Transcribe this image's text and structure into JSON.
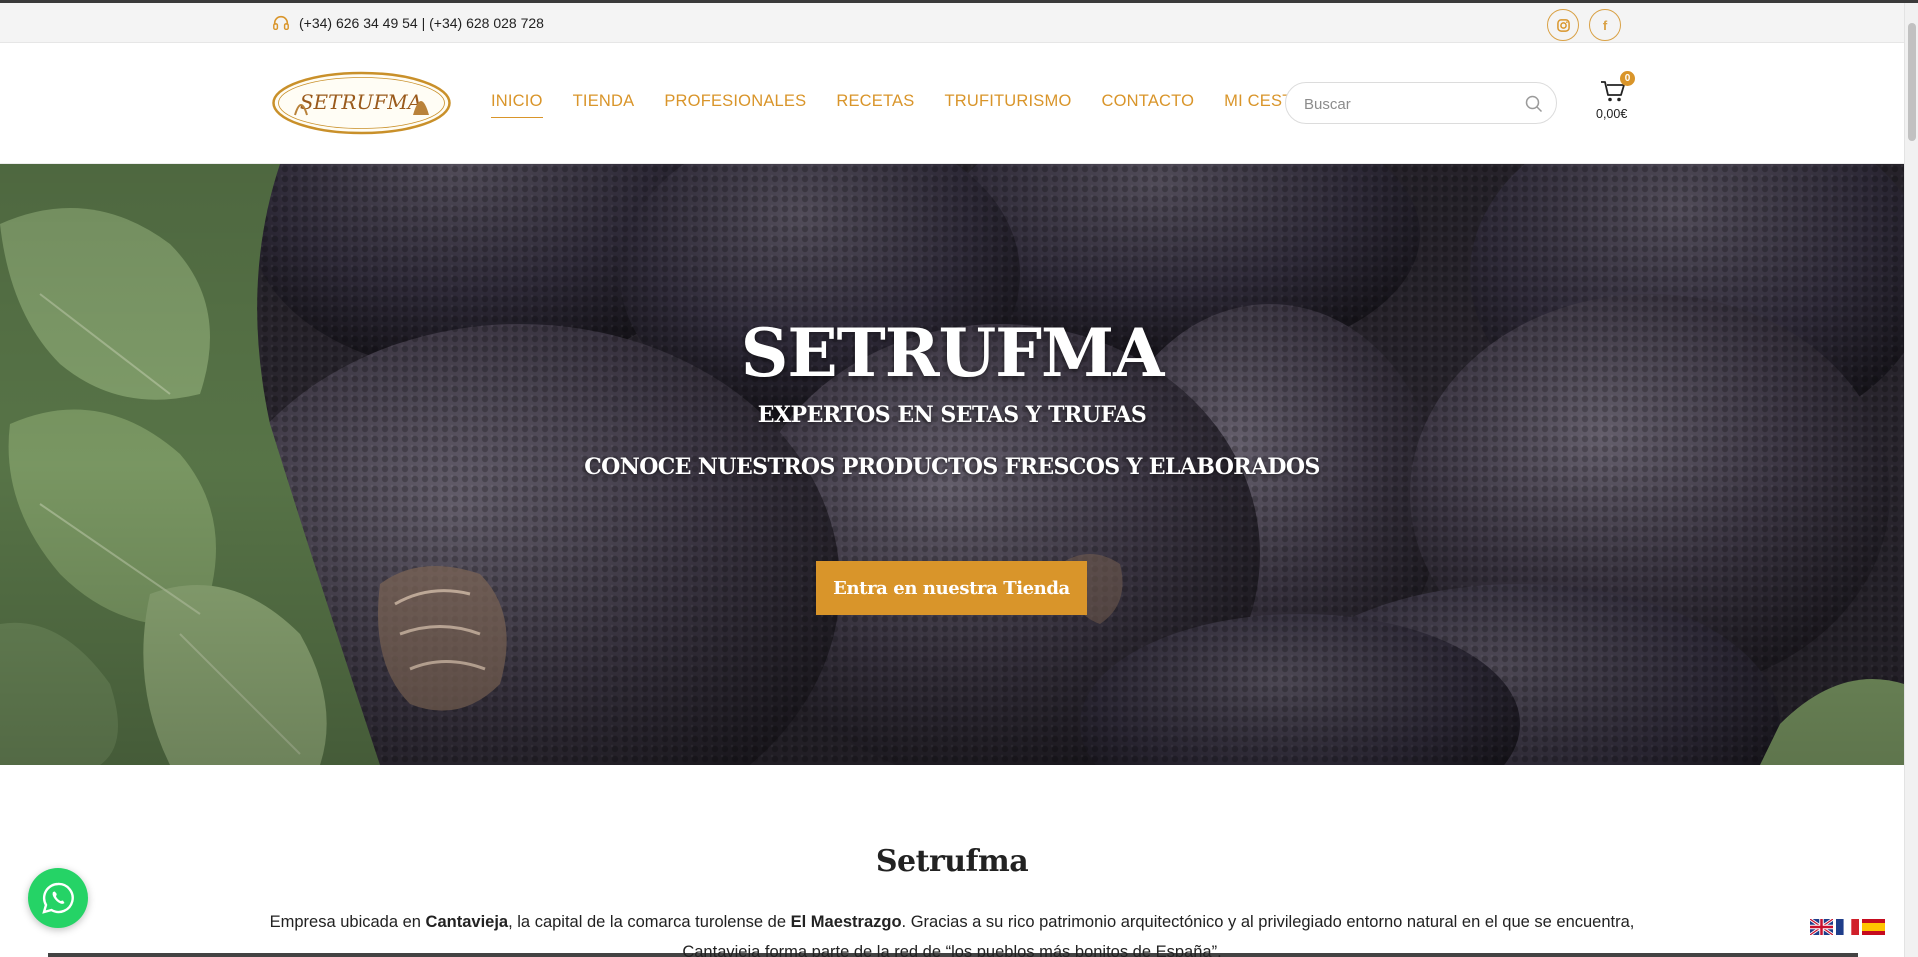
{
  "topbar": {
    "phone_icon": "headset-icon",
    "phone_text": "(+34) 626 34 49 54 | (+34) 628 028 728",
    "social": [
      {
        "name": "instagram",
        "icon": "instagram-icon",
        "glyph": "◎"
      },
      {
        "name": "facebook",
        "icon": "facebook-icon",
        "glyph": "f"
      }
    ]
  },
  "header": {
    "logo_text": "SETRUFMA",
    "nav": [
      {
        "label": "INICIO",
        "active": true
      },
      {
        "label": "TIENDA",
        "active": false
      },
      {
        "label": "PROFESIONALES",
        "active": false
      },
      {
        "label": "RECETAS",
        "active": false
      },
      {
        "label": "TRUFITURISMO",
        "active": false
      },
      {
        "label": "CONTACTO",
        "active": false
      },
      {
        "label": "MI CESTA",
        "active": false
      }
    ],
    "search": {
      "placeholder": "Buscar",
      "value": ""
    },
    "cart": {
      "count": "0",
      "total": "0,00€"
    }
  },
  "hero": {
    "title": "SETRUFMA",
    "subtitle": "EXPERTOS EN SETAS Y TRUFAS",
    "tagline": "CONOCE NUESTROS PRODUCTOS FRESCOS Y ELABORADOS",
    "cta_label": "Entra en nuestra Tienda"
  },
  "about": {
    "title": "Setrufma",
    "p1_a": "Empresa ubicada en ",
    "p1_b": "Cantavieja",
    "p1_c": ", la capital de la comarca turolense de ",
    "p1_d": "El Maestrazgo",
    "p1_e": ". Gracias a su rico patrimonio arquitectónico y al privilegiado entorno natural en el que se encuentra,",
    "p2": "Cantavieja forma parte de la red de “los pueblos más bonitos de España”."
  },
  "colors": {
    "accent": "#d9952a",
    "whatsapp": "#25d366",
    "hero_dark": "#3a3541"
  },
  "flags": [
    "english-flag",
    "french-flag",
    "spanish-flag"
  ]
}
